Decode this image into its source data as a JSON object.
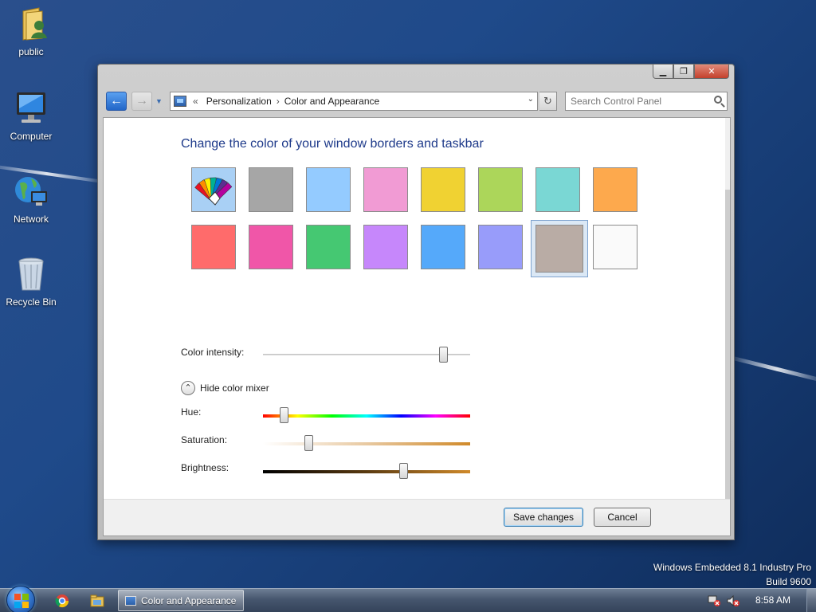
{
  "desktop": {
    "icons": [
      {
        "label": "public",
        "icon": "folder-user-icon"
      },
      {
        "label": "Computer",
        "icon": "computer-icon"
      },
      {
        "label": "Network",
        "icon": "network-globe-icon"
      },
      {
        "label": "Recycle Bin",
        "icon": "recycle-bin-icon"
      }
    ],
    "watermark": {
      "line1": "Windows Embedded 8.1 Industry Pro",
      "line2": "Build 9600"
    }
  },
  "window": {
    "caption_buttons": [
      "minimize",
      "maximize",
      "close"
    ],
    "address": {
      "prefix": "«",
      "crumbs": [
        "Personalization",
        "Color and Appearance"
      ],
      "separator": "›"
    },
    "search": {
      "placeholder": "Search Control Panel"
    },
    "heading": "Change the color of your window borders and taskbar",
    "swatches": [
      {
        "row": 1,
        "color": "#a9d0f5",
        "kind": "color-picker"
      },
      {
        "row": 1,
        "color": "#a6a6a6"
      },
      {
        "row": 1,
        "color": "#94cbff"
      },
      {
        "row": 1,
        "color": "#f19bd4"
      },
      {
        "row": 1,
        "color": "#f0d232"
      },
      {
        "row": 1,
        "color": "#acd65a"
      },
      {
        "row": 1,
        "color": "#7ad7d4"
      },
      {
        "row": 1,
        "color": "#fda94d"
      },
      {
        "row": 2,
        "color": "#ff6b6b"
      },
      {
        "row": 2,
        "color": "#f056a8"
      },
      {
        "row": 2,
        "color": "#45c872"
      },
      {
        "row": 2,
        "color": "#c687fb"
      },
      {
        "row": 2,
        "color": "#55a9fa"
      },
      {
        "row": 2,
        "color": "#989cfa"
      },
      {
        "row": 2,
        "color": "#b9aca5",
        "selected": true
      },
      {
        "row": 2,
        "color": "#fafafa"
      }
    ],
    "color_intensity": {
      "label": "Color intensity:",
      "value": 0.87
    },
    "mixer_toggle": "Hide color mixer",
    "hue": {
      "label": "Hue:",
      "value": 0.1
    },
    "saturation": {
      "label": "Saturation:",
      "value": 0.22
    },
    "brightness": {
      "label": "Brightness:",
      "value": 0.68
    },
    "buttons": {
      "save": "Save changes",
      "cancel": "Cancel"
    }
  },
  "taskbar": {
    "pinned": [
      "chrome-icon",
      "file-explorer-icon"
    ],
    "active_task": "Color and Appearance",
    "tray": [
      "network-warning-icon",
      "volume-muted-icon"
    ],
    "clock": "8:58 AM"
  }
}
